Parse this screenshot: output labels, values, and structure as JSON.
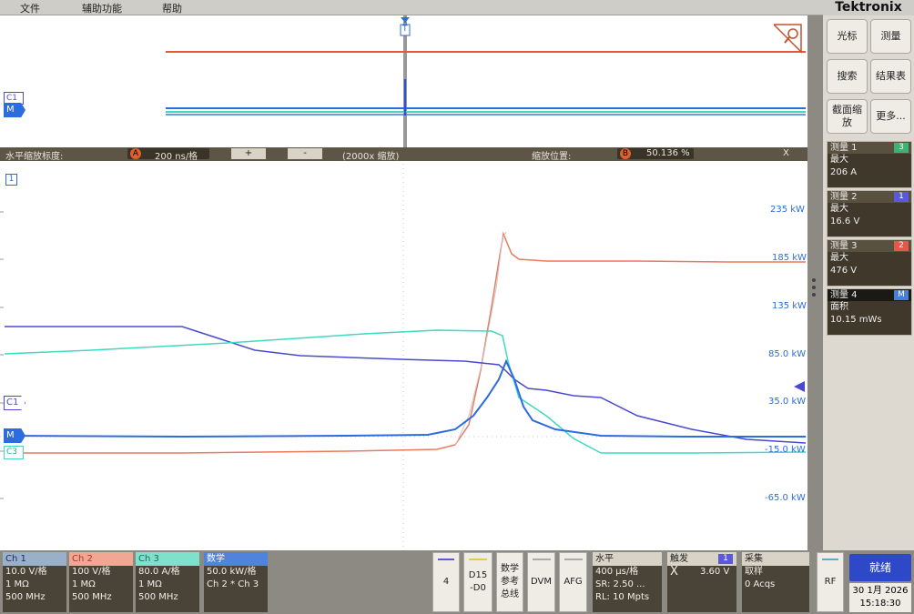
{
  "menu": {
    "file": "文件",
    "tools": "辅助功能",
    "help": "帮助"
  },
  "brand": "Tektronix",
  "right": {
    "cursor": "光标",
    "measure": "测量",
    "search": "搜索",
    "results": "结果表",
    "zoom": "截面缩放",
    "more": "更多..."
  },
  "measurements": [
    {
      "title": "测量 1",
      "badge": "3",
      "badge_color": "#3cb371",
      "type": "最大",
      "value": "206 A"
    },
    {
      "title": "测量 2",
      "badge": "1",
      "badge_color": "#5a5ad8",
      "type": "最大",
      "value": "16.6 V"
    },
    {
      "title": "测量 3",
      "badge": "2",
      "badge_color": "#e05a4a",
      "type": "最大",
      "value": "476 V"
    },
    {
      "title": "测量 4",
      "badge": "M",
      "badge_color": "#4a7fd8",
      "type": "面积",
      "value": "10.15 mWs"
    }
  ],
  "zoombar": {
    "hscale_label": "水平缩放标度:",
    "hscale_badge": "A",
    "hscale": "200 ns/格",
    "plus": "+",
    "minus": "-",
    "factor": "(2000x 缩放)",
    "pos_label": "缩放位置:",
    "pos_badge": "B",
    "pos": "50.136 %",
    "close": "X"
  },
  "markers": {
    "t": "T",
    "c1_top": "C1",
    "m_top": "M",
    "ref1": "1",
    "c1": "C1",
    "m": "M",
    "c3": "C3"
  },
  "axis_labels": [
    "235 kW",
    "185 kW",
    "135 kW",
    "85.0 kW",
    "35.0 kW",
    "-15.0 kW",
    "-65.0 kW"
  ],
  "channels": [
    {
      "name": "Ch 1",
      "color": "#9ab0c8",
      "l1": "10.0 V/格",
      "l2": "1 MΩ",
      "l3": "500 MHz"
    },
    {
      "name": "Ch 2",
      "color": "#f0a894",
      "l1": "100 V/格",
      "l2": "1 MΩ",
      "l3": "500 MHz"
    },
    {
      "name": "Ch 3",
      "color": "#7fe0cc",
      "l1": "80.0 A/格",
      "l2": "1 MΩ",
      "l3": "500 MHz"
    },
    {
      "name": "数学",
      "color": "#4f83dc",
      "l1": "50.0 kW/格",
      "l2": "Ch 2 * Ch 3",
      "l3": ""
    }
  ],
  "buttons": {
    "b4": "4",
    "d15": "D15\n-D0",
    "mathref": "数学\n参考\n总线",
    "dvm": "DVM",
    "afg": "AFG",
    "rf": "RF",
    "run": "就绪"
  },
  "horizontal": {
    "title": "水平",
    "l1": "400 μs/格",
    "l2": "SR: 2.50 ...",
    "l3": "RL: 10 Mpts"
  },
  "trigger": {
    "title": "触发",
    "badge": "1",
    "slope": "X",
    "level": "3.60 V"
  },
  "acquire": {
    "title": "采集",
    "mode": "取样",
    "count": "0 Acqs"
  },
  "datetime": {
    "date": "30 1月 2026",
    "time": "15:18:30"
  },
  "colors": {
    "ch1": "#4a4ad0",
    "ch2": "#e87a5f",
    "ch3": "#40d8c0",
    "math": "#2d6be0"
  }
}
